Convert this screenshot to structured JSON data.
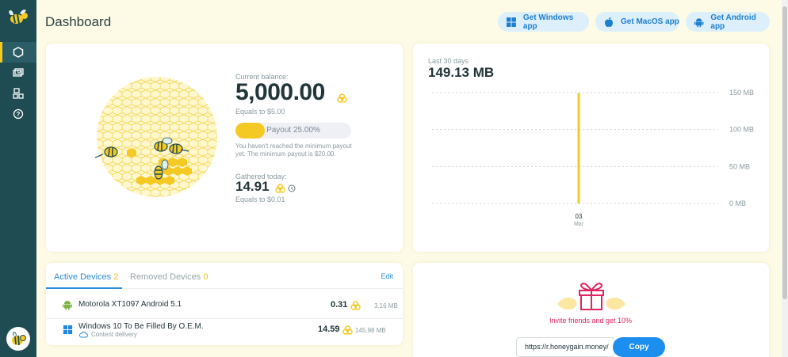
{
  "header": {
    "title": "Dashboard"
  },
  "apps": [
    {
      "label": "Get Windows app",
      "icon": "windows-icon"
    },
    {
      "label": "Get MacOS app",
      "icon": "apple-icon"
    },
    {
      "label": "Get Android app",
      "icon": "android-icon"
    }
  ],
  "sidebar": {
    "items": [
      {
        "name": "dashboard",
        "icon": "hexagon-icon"
      },
      {
        "name": "earnings",
        "icon": "money-icon"
      },
      {
        "name": "referrals",
        "icon": "people-icon"
      },
      {
        "name": "help",
        "icon": "help-icon"
      }
    ]
  },
  "balance": {
    "current_label": "Current balance:",
    "amount": "5,000.00",
    "equals": "Equals to $5.00",
    "payout_label": "Payout 25.00%",
    "payout_progress": 0.25,
    "payout_note": "You haven't reached the minimum payout yet. The minimum payout is $20.00.",
    "gathered_label": "Gathered today:",
    "gathered_amount": "14.91",
    "gathered_equals": "Equals to $0.01"
  },
  "usage": {
    "period_label": "Last 30 days",
    "total": "149.13 MB"
  },
  "chart_data": {
    "type": "bar",
    "categories": [
      "03"
    ],
    "category_sublabels": [
      "Mar"
    ],
    "values": [
      149.13
    ],
    "ylim": [
      0,
      150
    ],
    "yticks": [
      0,
      50,
      100,
      150
    ],
    "ytick_labels": [
      "0 MB",
      "50 MB",
      "100 MB",
      "150 MB"
    ],
    "grid": true,
    "bar_color": "#f5c924"
  },
  "devices": {
    "tab_active": "Active Devices",
    "tab_active_count": "2",
    "tab_removed": "Removed Devices",
    "tab_removed_count": "0",
    "edit": "Edit",
    "rows": [
      {
        "name": "Motorola XT1097 Android 5.1",
        "earn": "0.31",
        "data": "3.16 MB",
        "icon": "android-icon"
      },
      {
        "name": "Windows 10 To Be Filled By O.E.M.",
        "sub": "Content delivery",
        "earn": "14.59",
        "data": "145.98 MB",
        "icon": "windows-icon"
      }
    ]
  },
  "invite": {
    "text": "Invite friends and get 10%",
    "link": "https://r.honeygain.money/",
    "copy": "Copy"
  },
  "colors": {
    "accent": "#f5c924",
    "sidebar": "#1f4b53",
    "link": "#2b8ddb",
    "invite": "#e0245e"
  }
}
